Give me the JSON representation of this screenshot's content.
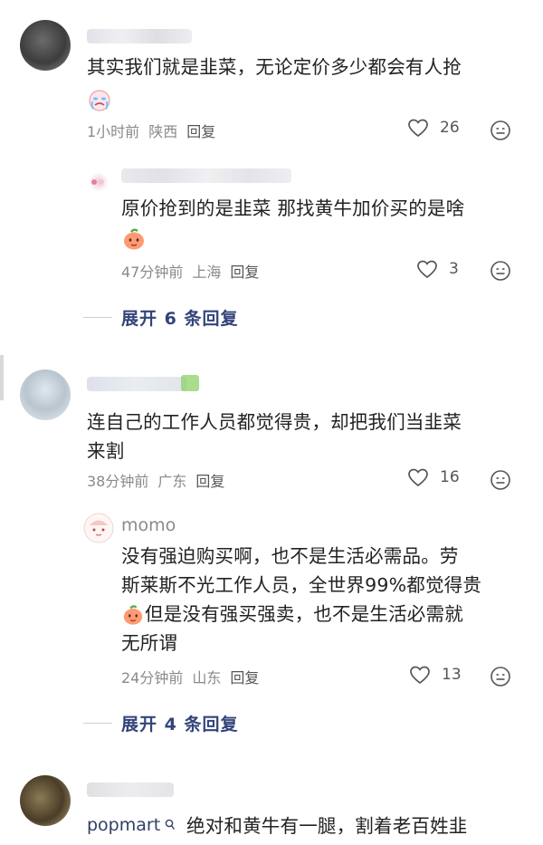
{
  "comments": [
    {
      "text": "其实我们就是韭菜，无论定价多少都会有人抢",
      "time": "1小时前",
      "location": "陕西",
      "reply_label": "回复",
      "likes": "26",
      "replies": [
        {
          "text": "原价抢到的是韭菜 那找黄牛加价买的是啥",
          "time": "47分钟前",
          "location": "上海",
          "reply_label": "回复",
          "likes": "3"
        }
      ],
      "expand_label": "展开 6 条回复"
    },
    {
      "text_line1": "连自己的工作人员都觉得贵，却把我们当韭菜",
      "text_line2": "来割",
      "time": "38分钟前",
      "location": "广东",
      "reply_label": "回复",
      "likes": "16",
      "replies": [
        {
          "username": "momo",
          "text_line1": "没有强迫购买啊，也不是生活必需品。劳",
          "text_line2": "斯莱斯不光工作人员，全世界99%都觉得贵",
          "text_line3": "但是没有强买强卖，也不是生活必需就",
          "text_line4": "无所谓",
          "time": "24分钟前",
          "location": "山东",
          "reply_label": "回复",
          "likes": "13"
        }
      ],
      "expand_label": "展开 4 条回复"
    },
    {
      "username": "popmart",
      "text": "绝对和黄牛有一腿，割着老百姓韭"
    }
  ],
  "icons": {
    "heart": "heart-outline-icon",
    "emoji": "emoji-face-icon",
    "search": "search-icon"
  },
  "colors": {
    "expand_text": "#33447a",
    "meta_text": "#8a8a8a",
    "username_link": "#304064"
  }
}
